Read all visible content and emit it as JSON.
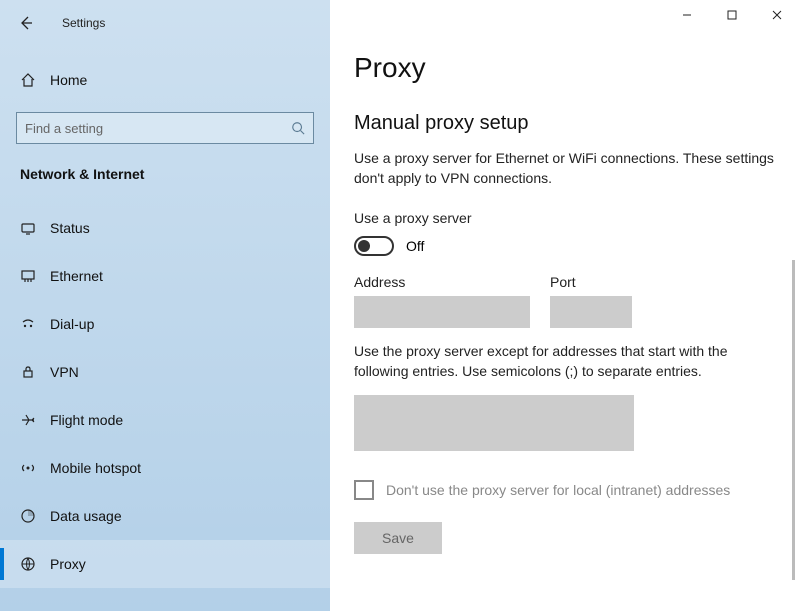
{
  "titlebar": {
    "title": "Settings"
  },
  "home": {
    "label": "Home"
  },
  "search": {
    "placeholder": "Find a setting"
  },
  "category": "Network & Internet",
  "nav": [
    {
      "label": "Status"
    },
    {
      "label": "Ethernet"
    },
    {
      "label": "Dial-up"
    },
    {
      "label": "VPN"
    },
    {
      "label": "Flight mode"
    },
    {
      "label": "Mobile hotspot"
    },
    {
      "label": "Data usage"
    },
    {
      "label": "Proxy"
    }
  ],
  "page": {
    "title": "Proxy",
    "section": "Manual proxy setup",
    "desc": "Use a proxy server for Ethernet or WiFi connections. These settings don't apply to VPN connections.",
    "use_proxy_label": "Use a proxy server",
    "toggle_state": "Off",
    "address_label": "Address",
    "port_label": "Port",
    "address_value": "",
    "port_value": "",
    "exceptions_desc": "Use the proxy server except for addresses that start with the following entries. Use semicolons (;) to separate entries.",
    "exceptions_value": "",
    "intranet_label": "Don't use the proxy server for local (intranet) addresses",
    "save_label": "Save"
  }
}
